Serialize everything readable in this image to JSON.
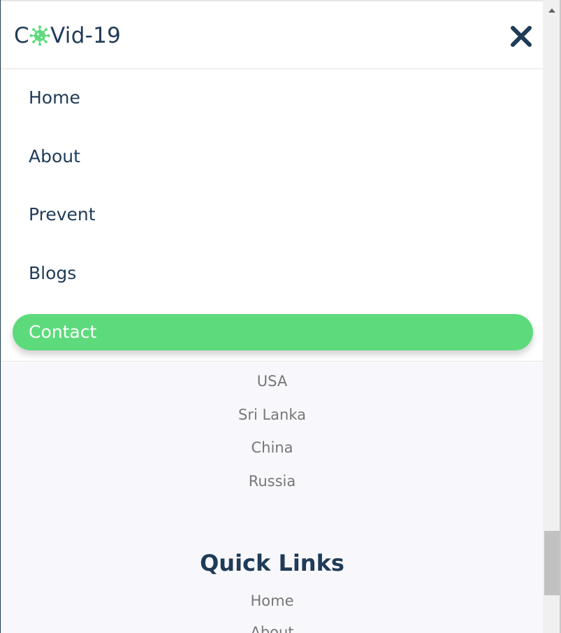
{
  "header": {
    "logo_prefix": "C",
    "logo_icon": "virus-icon",
    "logo_suffix": "Vid-19",
    "close_icon": "close-icon"
  },
  "menu": {
    "items": [
      {
        "label": "Home"
      },
      {
        "label": "About"
      },
      {
        "label": "Prevent"
      },
      {
        "label": "Blogs"
      },
      {
        "label": "Contact",
        "active": true
      }
    ]
  },
  "footer": {
    "countries": [
      "USA",
      "Sri Lanka",
      "China",
      "Russia"
    ],
    "quick_links_title": "Quick Links",
    "quick_links": [
      "Home",
      "About"
    ]
  },
  "colors": {
    "brand_dark": "#1f3b57",
    "accent_green": "#5ddb7c",
    "muted_text": "#777777",
    "footer_bg": "#f8f8fc"
  }
}
